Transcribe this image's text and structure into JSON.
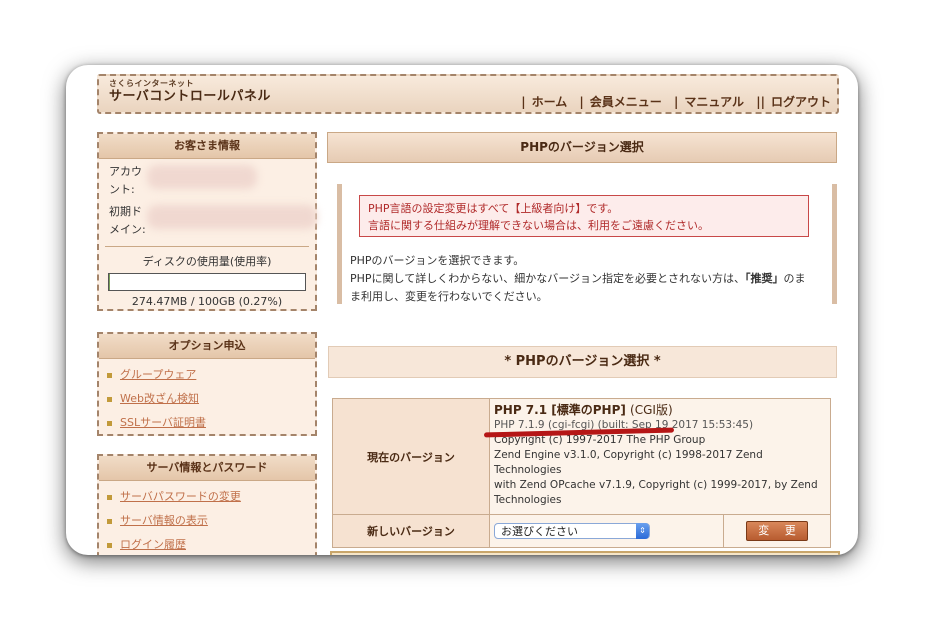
{
  "header": {
    "brand_small": "さくらインターネット",
    "brand_large": "サーバコントロールパネル",
    "nav": [
      "ホーム",
      "会員メニュー",
      "マニュアル",
      "ログアウト"
    ]
  },
  "customer": {
    "title": "お客さま情報",
    "account_label_1": "アカウ",
    "account_label_2": "ント:",
    "domain_label_1": "初期ド",
    "domain_label_2": "メイン:",
    "disk_heading": "ディスクの使用量(使用率)",
    "disk_usage": "274.47MB / 100GB (0.27%)",
    "disk_percent": 0.27
  },
  "options": {
    "title": "オプション申込",
    "items": [
      "グループウェア",
      "Web改ざん検知",
      "SSLサーバ証明書"
    ]
  },
  "server_info": {
    "title": "サーバ情報とパスワード",
    "items": [
      "サーバパスワードの変更",
      "サーバ情報の表示",
      "ログイン履歴"
    ]
  },
  "main": {
    "panel_title": "PHPのバージョン選択",
    "warning_line1": "PHP言語の設定変更はすべて【上級者向け】です。",
    "warning_line2": "言語に関する仕組みが理解できない場合は、利用をご遠慮ください。",
    "desc_line1": "PHPのバージョンを選択できます。",
    "desc_line2a": "PHPに関して詳しくわからない、細かなバージョン指定を必要とされない方は、",
    "desc_bold": "「推奨」",
    "desc_line2b": "のまま利用し、変更を行わないでください。",
    "section_title": "* PHPのバージョン選択 *",
    "current_label": "現在のバージョン",
    "current_version": "PHP 7.1 [標準のPHP]",
    "current_version_suffix": "(CGI版)",
    "build_info": "PHP 7.1.9 (cgi-fcgi) (built: Sep 19 2017 15:53:45)",
    "copyright1": "Copyright (c) 1997-2017 The PHP Group",
    "copyright2": "Zend Engine v3.1.0, Copyright (c) 1998-2017 Zend Technologies",
    "copyright3": "with Zend OPcache v7.1.9, Copyright (c) 1999-2017, by Zend Technologies",
    "new_label": "新しいバージョン",
    "select_value": "お選びください",
    "change_button": "変 更"
  }
}
